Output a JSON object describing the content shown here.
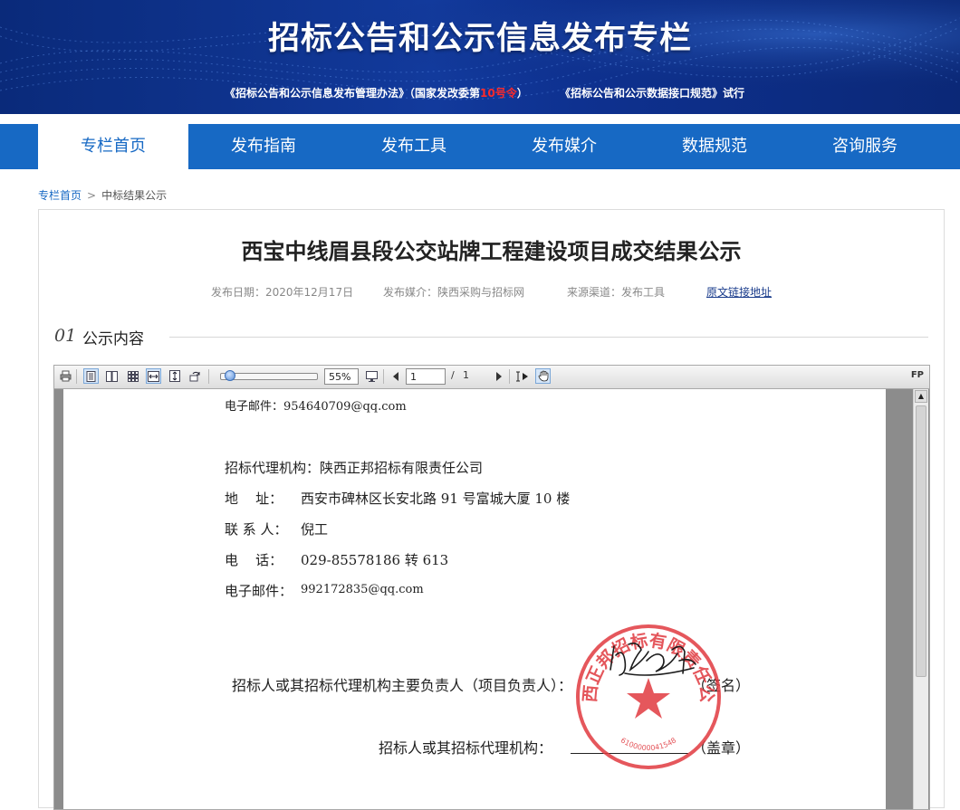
{
  "banner": {
    "title": "招标公告和公示信息发布专栏",
    "sub1_a": "《招标公告和公示信息发布管理办法》（国家发改委第",
    "sub1_red": "10号令",
    "sub1_b": "）",
    "sub2": "《招标公告和公示数据接口规范》试行"
  },
  "nav": {
    "items": [
      {
        "label": "专栏首页"
      },
      {
        "label": "发布指南"
      },
      {
        "label": "发布工具"
      },
      {
        "label": "发布媒介"
      },
      {
        "label": "数据规范"
      },
      {
        "label": "咨询服务"
      }
    ],
    "active_index": 0
  },
  "breadcrumb": {
    "home": "专栏首页",
    "separator": ">",
    "current": "中标结果公示"
  },
  "article": {
    "title": "西宝中线眉县段公交站牌工程建设项目成交结果公示",
    "publish_date": "发布日期：2020年12月17日",
    "media": "发布媒介：陕西采购与招标网",
    "source": "来源渠道：发布工具",
    "original_link": "原文链接地址",
    "section_num": "01",
    "section_title": "公示内容"
  },
  "viewer": {
    "zoom": "55%",
    "page_current": "1",
    "page_slash": "/",
    "page_total": "1",
    "brand": "FP",
    "scroll_up_glyph": "▲"
  },
  "document": {
    "email1": "电子邮件：954640709@qq.com",
    "agency": "招标代理机构：陕西正邦招标有限责任公司",
    "address_label": "地    址：",
    "address": "西安市碑林区长安北路 91 号富城大厦 10 楼",
    "contact_label": "联 系 人：",
    "contact": "倪工",
    "phone_label": "电    话：",
    "phone": "029-85578186 转 613",
    "email2_label": "电子邮件：",
    "email2": "992172835@qq.com",
    "sign_line": "招标人或其招标代理机构主要负责人（项目负责人）：",
    "sign_suffix": "（签名）",
    "seal_line": "招标人或其招标代理机构：",
    "seal_suffix": "（盖章）",
    "stamp_text": "陕西正邦招标有限责任公司",
    "stamp_number": "6100000041548"
  },
  "colors": {
    "nav_blue": "#1769c4",
    "stamp_red": "#e0393f",
    "highlight_red": "#ff2a2a"
  }
}
